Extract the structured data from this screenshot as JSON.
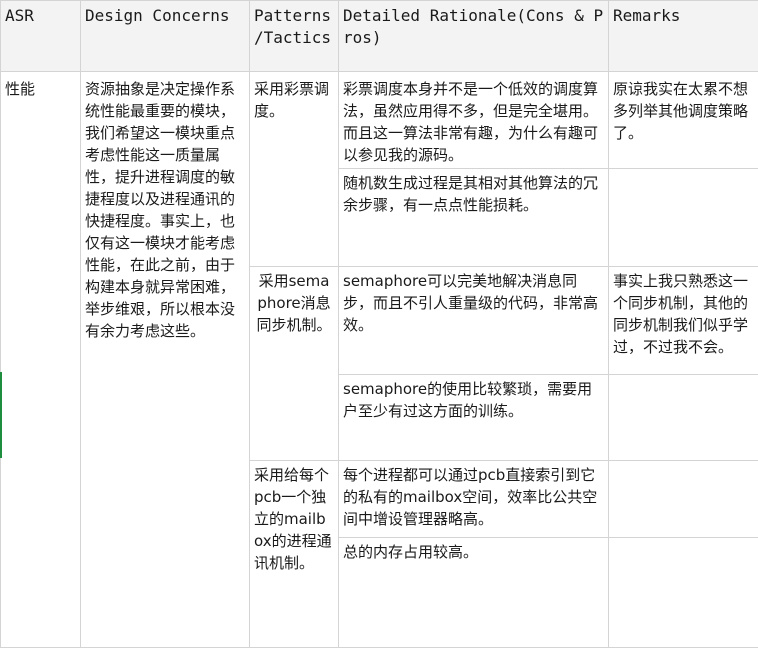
{
  "table": {
    "headers": [
      "ASR",
      "Design Concerns",
      "Patterns /Tactics",
      "Detailed Rationale(Cons & Pros)",
      "Remarks"
    ],
    "asr": "性能",
    "design_concerns": "资源抽象是决定操作系统性能最重要的模块，我们希望这一模块重点考虑性能这一质量属性，提升进程调度的敏捷程度以及进程通讯的快捷程度。事实上，也仅有这一模块才能考虑性能，在此之前，由于构建本身就异常困难，举步维艰，所以根本没有余力考虑这些。",
    "patterns": [
      {
        "tactic": "采用彩票调度。",
        "rationales": [
          "彩票调度本身并不是一个低效的调度算法，虽然应用得不多，但是完全堪用。而且这一算法非常有趣，为什么有趣可以参见我的源码。",
          "随机数生成过程是其相对其他算法的冗余步骤，有一点点性能损耗。"
        ],
        "remarks": [
          "原谅我实在太累不想多列举其他调度策略了。",
          ""
        ]
      },
      {
        "tactic": "采用semaphore消息同步机制。",
        "rationales": [
          "semaphore可以完美地解决消息同步，而且不引人重量级的代码，非常高效。",
          "semaphore的使用比较繁琐，需要用户至少有过这方面的训练。"
        ],
        "remarks": [
          "事实上我只熟悉这一个同步机制，其他的同步机制我们似乎学过，不过我不会。",
          ""
        ]
      },
      {
        "tactic": "采用给每个pcb一个独立的mailbox的进程通讯机制。",
        "rationales": [
          "每个进程都可以通过pcb直接索引到它的私有的mailbox空间，效率比公共空间中增设管理器略高。",
          "总的内存占用较高。"
        ],
        "remarks": [
          "",
          ""
        ]
      }
    ]
  },
  "colors": {
    "header_bg": "#f3f3f3",
    "grid_line": "#d4d4d4",
    "row_marker": "#1e8e3e"
  }
}
